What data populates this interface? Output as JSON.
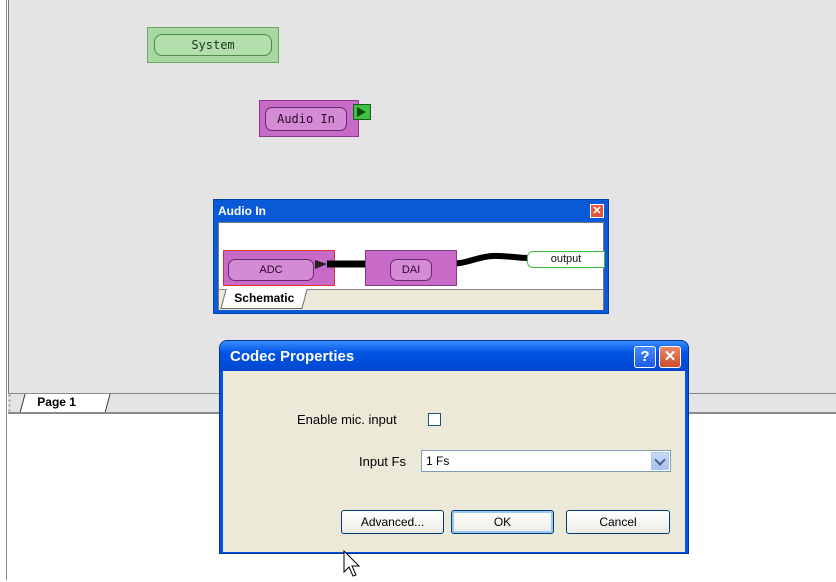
{
  "canvas": {
    "system_block": "System",
    "audio_block": "Audio In"
  },
  "subwindow": {
    "title": "Audio In",
    "close_glyph": "✕",
    "adc_label": "ADC",
    "dai_label": "DAI",
    "output_label": "output",
    "tab_label": "Schematic"
  },
  "page_tab": "Page 1",
  "dialog": {
    "title": "Codec Properties",
    "help_glyph": "?",
    "close_glyph": "✕",
    "enable_mic_label": "Enable mic. input",
    "enable_mic_checked": false,
    "input_fs_label": "Input Fs",
    "input_fs_value": "1 Fs",
    "advanced_button": "Advanced...",
    "ok_button": "OK",
    "cancel_button": "Cancel"
  },
  "colors": {
    "accent_blue": "#0054e3",
    "block_purple": "#c86ac8",
    "block_green": "#a8d8a2"
  }
}
